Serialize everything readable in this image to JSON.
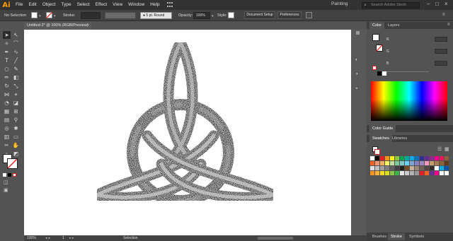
{
  "app": {
    "logo": "Ai",
    "workspace": "Painting",
    "search_placeholder": "Search Adobe Stock"
  },
  "menu": [
    "File",
    "Edit",
    "Object",
    "Type",
    "Select",
    "Effect",
    "View",
    "Window",
    "Help"
  ],
  "control_bar": {
    "selection": "No Selection",
    "stroke_label": "Stroke:",
    "brush": "5 pt. Round",
    "opacity_label": "Opacity:",
    "opacity_value": "100%",
    "style_label": "Style:",
    "document_setup": "Document Setup",
    "preferences": "Preferences"
  },
  "document": {
    "tab_title": "Untitled-2* @ 100% (RGB/Preview)",
    "close": "×"
  },
  "status": {
    "zoom": "100%",
    "page": "1",
    "mode": "Selection"
  },
  "color_panel": {
    "tabs": [
      "Color",
      "Layers"
    ],
    "channels": [
      "R",
      "G",
      "B"
    ]
  },
  "color_guide": {
    "title": "Color Guide"
  },
  "swatches_panel": {
    "tabs": [
      "Swatches",
      "Libraries"
    ]
  },
  "bottom_tabs": [
    "Brushes",
    "Stroke",
    "Symbols"
  ],
  "swatch_colors": [
    "#ffffff",
    "#000000",
    "#ed1c24",
    "#f7941d",
    "#fff200",
    "#8dc63f",
    "#00a651",
    "#00a99d",
    "#00aeef",
    "#0072bc",
    "#2e3192",
    "#662d91",
    "#92278f",
    "#ec008c",
    "#ed145b",
    "#8b5e3c",
    "#f26522",
    "#f7977a",
    "#fbaf5d",
    "#fff568",
    "#c4df9b",
    "#82ca9c",
    "#7accc8",
    "#6dcff6",
    "#7da7d9",
    "#8781bd",
    "#a187be",
    "#f49ac2",
    "#c69c6d",
    "#a67c52",
    "#8c6239",
    "#603913",
    "#e0e0e0",
    "#c0c0c0",
    "#a0a0a0",
    "#808080",
    "#606060",
    "#404040",
    "#202020",
    "#754c24",
    "#c7b299",
    "#998675",
    "#736357",
    "#534741",
    "#362f2d",
    "#ffffff",
    "#00aeef",
    "#0054a6",
    "#f7941d",
    "#fbb040",
    "#ffde17",
    "#d7df23",
    "#8dc63f",
    "#39b54a",
    "#e6e6e6",
    "#cccccc",
    "#b3b3b3",
    "#999999",
    "#ed1c24",
    "#f26522",
    "#662d91",
    "#ec008c",
    "#ffffff",
    "#ffffff"
  ],
  "colors": {
    "accent": "#ff9a00",
    "chrome_dark": "#323232",
    "panel": "#535353",
    "canvas": "#ffffff"
  }
}
